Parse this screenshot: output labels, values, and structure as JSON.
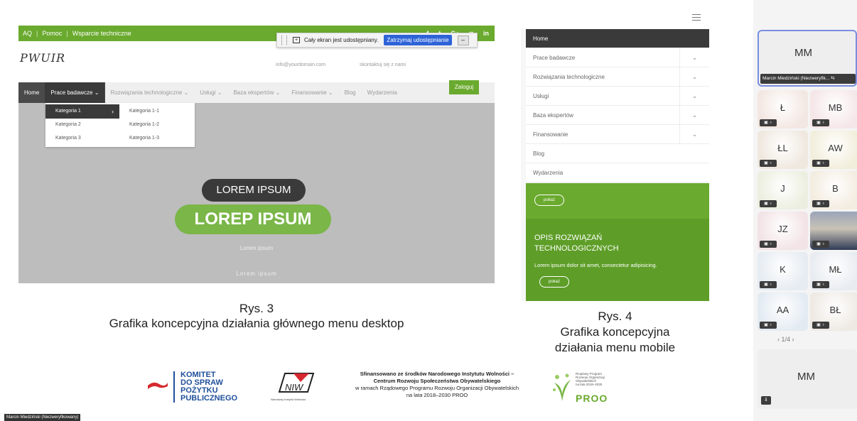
{
  "desktop": {
    "topbar": {
      "faq": "AQ",
      "sep": "|",
      "help": "Pomoc",
      "support": "Wsparcie techniczne"
    },
    "social": [
      "f",
      "t",
      "G+",
      "◘",
      "in"
    ],
    "logo": "PWUIR",
    "contact": {
      "email": "info@yourdomain.com",
      "call": "skontaktuj się z nami"
    },
    "share_bar": {
      "message": "Cały ekran jest udostępniany.",
      "stop_label": "Zatrzymaj udostępnianie",
      "minimize_label": "–"
    },
    "nav": [
      "Home",
      "Prace badawcze ⌄",
      "Rozwiązania technologiczne ⌄",
      "Usługi ⌄",
      "Baza ekspertów ⌄",
      "Finansowanie ⌄",
      "Blog",
      "Wydarzenia"
    ],
    "login": "Zaloguj",
    "dropdown": {
      "col1": [
        "Kategoria 1",
        "Kategoria 2",
        "Kategoria 3"
      ],
      "col2": [
        "Kategoria 1-1",
        "Kategoria 1-2",
        "Kategoria 1-3"
      ]
    },
    "hero": {
      "pill_dark": "LOREM IPSUM",
      "pill_green": "LOREP IPSUM",
      "small1": "Lorem ipsum",
      "small2": "Lorem ipsum"
    },
    "caption_line1": "Rys. 3",
    "caption_line2": "Grafika koncepcyjna działania głównego menu desktop"
  },
  "mobile": {
    "menu": [
      "Home",
      "Prace badawcze",
      "Rozwiązania technologiczne",
      "Usługi",
      "Baza ekspertów",
      "Finansowanie",
      "Blog",
      "Wydarzenia"
    ],
    "chevron": "⌄",
    "pokaz": "pokaż",
    "heading_line1": "OPIS ROZWIĄZAŃ",
    "heading_line2": "TECHNOLOGICZNYCH",
    "para": "Lorem ipsum dolor sit amet, consectetur adipisicing.",
    "caption_line1": "Rys. 4",
    "caption_line2": "Grafika koncepcyjna",
    "caption_line3": "działania menu mobile"
  },
  "logos": {
    "komitet": [
      "KOMITET",
      "DO SPRAW",
      "POŻYTKU",
      "PUBLICZNEGO"
    ],
    "niw": "NIW",
    "niw_sub": "Narodowy Instytut Wolności",
    "funding_line1": "Sfinansowano ze środków Narodowego Instytutu Wolności –",
    "funding_line2": "Centrum Rozwoju Społeczeństwa Obywatelskiego",
    "funding_line3": "w ramach Rządowego Programu Rozwoju Organizacji Obywatelskich",
    "funding_line4": "na lata 2018–2030 PROO",
    "proo_small": [
      "Rządowy Program",
      "Rozwoju Organizacji",
      "Obywatelskich",
      "na lata 2018–2030"
    ],
    "proo": "PROO"
  },
  "presenter_bar": "Marcin Miedziński (Niezweryfikowany)",
  "participants": {
    "main": {
      "initials": "MM",
      "name": "Marcin Miedziński (Niezweryfik...",
      "icon": "⇆"
    },
    "tiles": [
      {
        "initials": "Ł"
      },
      {
        "initials": "MB"
      },
      {
        "initials": "ŁL"
      },
      {
        "initials": "AW"
      },
      {
        "initials": "J"
      },
      {
        "initials": "B"
      },
      {
        "initials": "JZ"
      },
      {
        "initials": ""
      },
      {
        "initials": "K"
      },
      {
        "initials": "MŁ"
      },
      {
        "initials": "AA"
      },
      {
        "initials": "BŁ"
      }
    ],
    "tile_icons": "▣ ♁",
    "pager": "‹   1/4   ›",
    "bottom": {
      "initials": "MM",
      "icon": "⇓"
    }
  },
  "colors": {
    "green": "#6aaa2e",
    "dark": "#3a3a3a",
    "accent_border": "#7a8ee0",
    "share_blue": "#2e63d8"
  }
}
